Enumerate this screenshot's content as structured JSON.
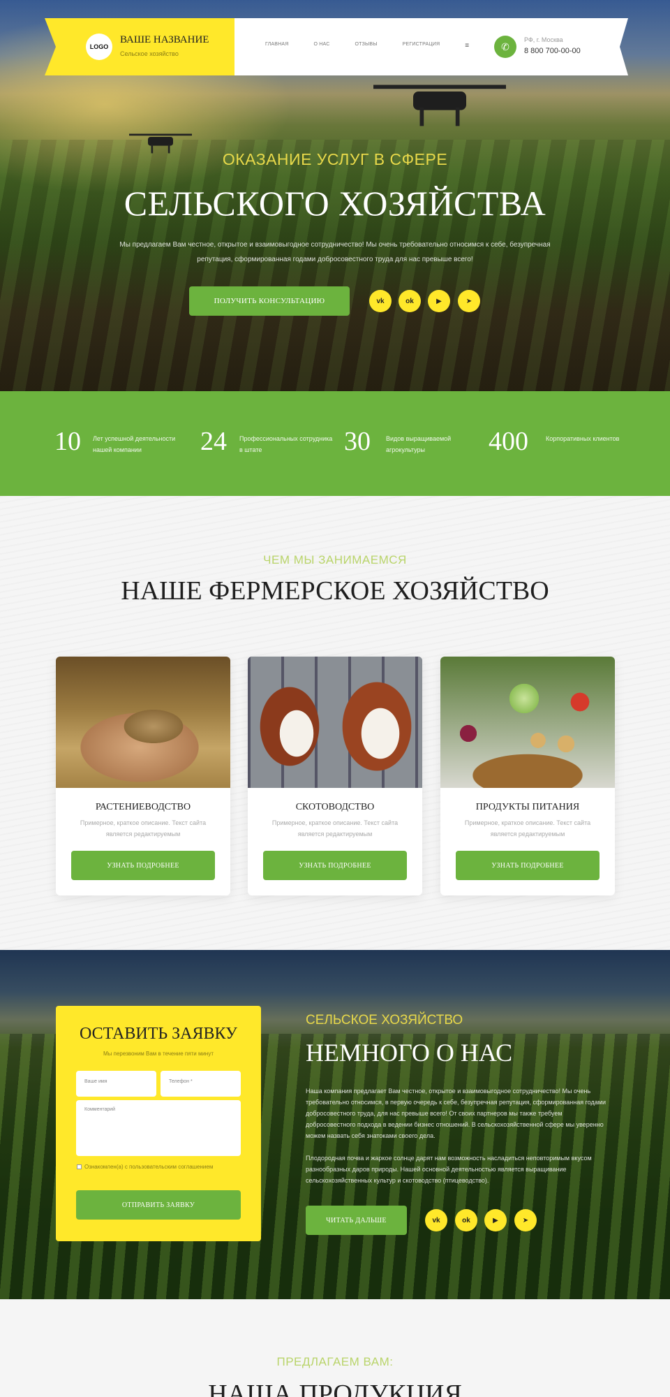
{
  "header": {
    "logo": "LOGO",
    "brand_name": "ВАШЕ НАЗВАНИЕ",
    "brand_sub": "Сельское хозяйство",
    "nav": [
      "ГЛАВНАЯ",
      "О НАС",
      "ОТЗЫВЫ",
      "РЕГИСТРАЦИЯ"
    ],
    "city": "РФ, г. Москва",
    "phone": "8 800 700-00-00"
  },
  "hero": {
    "kicker": "ОКАЗАНИЕ УСЛУГ В СФЕРЕ",
    "title": "СЕЛЬСКОГО ХОЗЯЙСТВА",
    "text": "Мы предлагаем Вам честное, открытое и взаимовыгодное сотрудничество! Мы очень требовательно относимся к себе, безупречная репутация, сформированная годами добросовестного труда для нас превыше всего!",
    "button": "ПОЛУЧИТЬ КОНСУЛЬТАЦИЮ",
    "social": [
      "vk",
      "ok",
      "yt",
      "tg"
    ]
  },
  "stats": [
    {
      "num": "10",
      "label": "Лет успешной деятельности нашей компании"
    },
    {
      "num": "24",
      "label": "Профессиональных сотрудника в штате"
    },
    {
      "num": "30",
      "label": "Видов выращиваемой агрокультуры"
    },
    {
      "num": "400",
      "label": "Корпоративных клиентов"
    }
  ],
  "farm": {
    "kicker": "ЧЕМ МЫ ЗАНИМАЕМСЯ",
    "title": "НАШЕ ФЕРМЕРСКОЕ ХОЗЯЙСТВО",
    "cards": [
      {
        "title": "РАСТЕНИЕВОДСТВО",
        "desc": "Примерное, краткое описание. Текст сайта является редактируемым",
        "button": "УЗНАТЬ ПОДРОБНЕЕ"
      },
      {
        "title": "СКОТОВОДСТВО",
        "desc": "Примерное, краткое описание. Текст сайта является редактируемым",
        "button": "УЗНАТЬ ПОДРОБНЕЕ"
      },
      {
        "title": "ПРОДУКТЫ ПИТАНИЯ",
        "desc": "Примерное, краткое описание. Текст сайта является редактируемым",
        "button": "УЗНАТЬ ПОДРОБНЕЕ"
      }
    ]
  },
  "form": {
    "title": "ОСТАВИТЬ ЗАЯВКУ",
    "sub": "Мы перезвоним Вам в течение пяти минут",
    "name_placeholder": "Ваше имя",
    "phone_placeholder": "Телефон *",
    "comment_placeholder": "Комментарий",
    "agree": "Ознакомлен(а) с пользовательским соглашением",
    "submit": "ОТПРАВИТЬ ЗАЯВКУ"
  },
  "about": {
    "kicker": "СЕЛЬСКОЕ ХОЗЯЙСТВО",
    "title": "НЕМНОГО О НАС",
    "text1": "Наша компания предлагает Вам честное, открытое и взаимовыгодное сотрудничество! Мы очень требовательно относимся, в первую очередь к себе, безупречная репутация, сформированная годами добросовестного труда, для нас превыше всего! От своих партнеров мы также требуем добросовестного подхода в ведении бизнес отношений. В сельскохозяйственной сфере мы уверенно можем назвать себя знатоками своего дела.",
    "text2": "Плодородная почва и жаркое солнце дарят нам возможность насладиться неповторимым вкусом разнообразных даров природы. Нашей основной деятельностью является выращивание сельскохозяйственных культур и скотоводство (птицеводство).",
    "button": "ЧИТАТЬ ДАЛЬШЕ"
  },
  "offer": {
    "kicker": "ПРЕДЛАГАЕМ ВАМ:",
    "title": "НАША ПРОДУКЦИЯ"
  }
}
